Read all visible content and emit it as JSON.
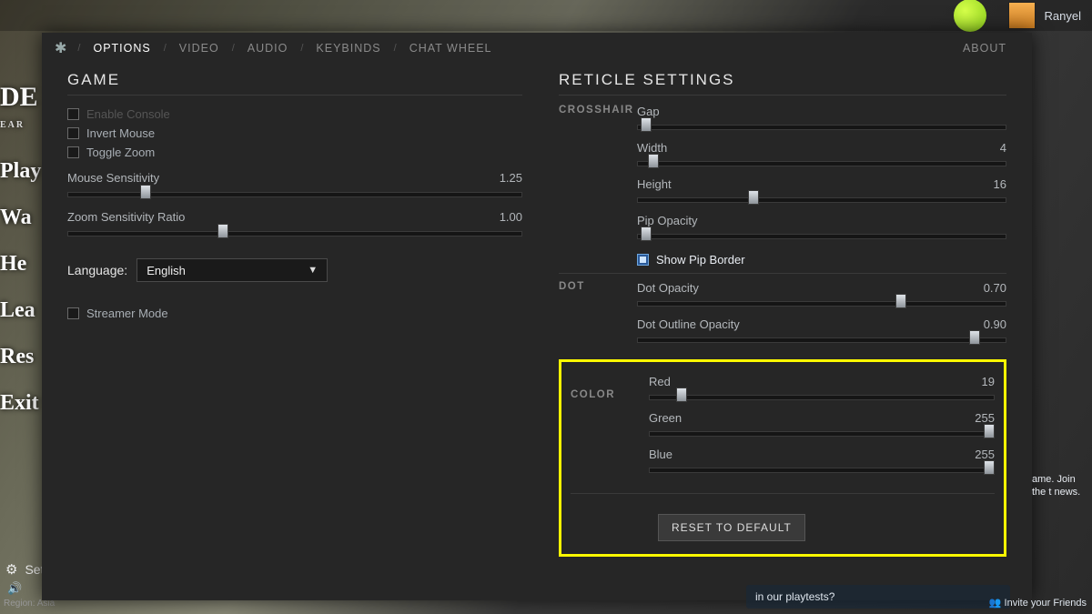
{
  "topbar": {
    "username": "Ranyel"
  },
  "left_edge": [
    "DE",
    "Play",
    "Wa",
    "He",
    "Lea",
    "Res",
    "Exit G"
  ],
  "left_edge_sub": "EAR",
  "bottom": {
    "settings": "Sett",
    "region": "Region: Asia"
  },
  "tabs": {
    "items": [
      "OPTIONS",
      "VIDEO",
      "AUDIO",
      "KEYBINDS",
      "CHAT WHEEL"
    ],
    "active_index": 0,
    "about": "ABOUT"
  },
  "game": {
    "title": "GAME",
    "checks": [
      {
        "label": "Enable Console",
        "checked": false,
        "dim": true
      },
      {
        "label": "Invert Mouse",
        "checked": false
      },
      {
        "label": "Toggle Zoom",
        "checked": false
      }
    ],
    "sliders": [
      {
        "label": "Mouse Sensitivity",
        "value": "1.25",
        "percent": 16
      },
      {
        "label": "Zoom Sensitivity Ratio",
        "value": "1.00",
        "percent": 33
      }
    ],
    "language": {
      "label": "Language:",
      "value": "English"
    },
    "streamer": {
      "label": "Streamer Mode",
      "checked": false
    }
  },
  "reticle": {
    "title": "RETICLE SETTINGS",
    "crosshair": {
      "label": "CROSSHAIR",
      "sliders": [
        {
          "label": "Gap",
          "value": "",
          "percent": 1
        },
        {
          "label": "Width",
          "value": "4",
          "percent": 3
        },
        {
          "label": "Height",
          "value": "16",
          "percent": 30
        },
        {
          "label": "Pip Opacity",
          "value": "",
          "percent": 1
        }
      ],
      "pip_border": {
        "label": "Show Pip Border",
        "checked": true
      }
    },
    "dot": {
      "label": "DOT",
      "sliders": [
        {
          "label": "Dot Opacity",
          "value": "0.70",
          "percent": 70
        },
        {
          "label": "Dot Outline Opacity",
          "value": "0.90",
          "percent": 90
        }
      ]
    },
    "color": {
      "label": "COLOR",
      "sliders": [
        {
          "label": "Red",
          "value": "19",
          "percent": 8
        },
        {
          "label": "Green",
          "value": "255",
          "percent": 100
        },
        {
          "label": "Blue",
          "value": "255",
          "percent": 100
        }
      ]
    },
    "reset": "RESET TO DEFAULT"
  },
  "right_hints": {
    "join": "ame. Join the\n t news.",
    "playtests": "in our playtests?",
    "invite": "Invite your Friends"
  }
}
